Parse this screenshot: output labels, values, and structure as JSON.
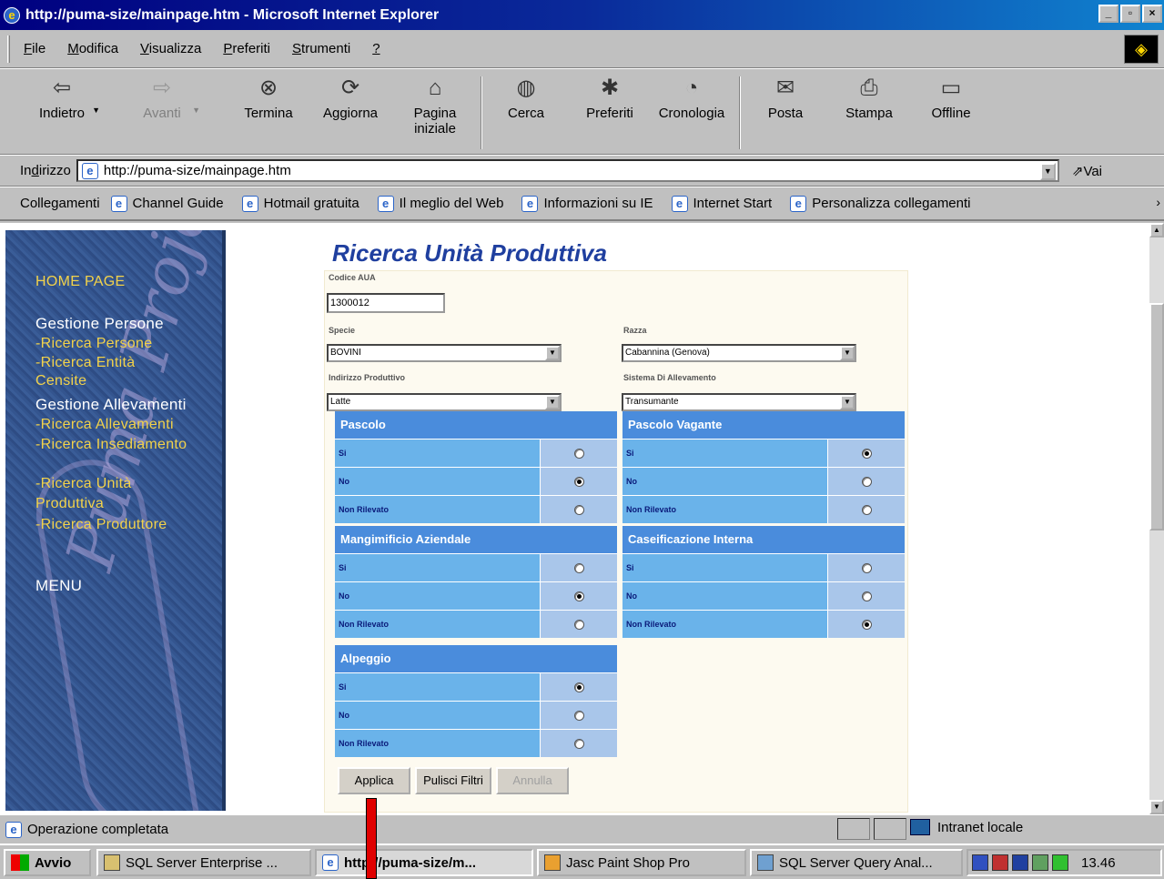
{
  "window": {
    "title": "http://puma-size/mainpage.htm - Microsoft Internet Explorer",
    "controls": [
      "_",
      "▫",
      "×"
    ]
  },
  "menubar": {
    "items": [
      {
        "label": "File",
        "u": "F",
        "rest": "ile"
      },
      {
        "label": "Modifica",
        "u": "M",
        "rest": "odifica"
      },
      {
        "label": "Visualizza",
        "u": "V",
        "rest": "isualizza"
      },
      {
        "label": "Preferiti",
        "u": "P",
        "rest": "referiti"
      },
      {
        "label": "Strumenti",
        "u": "S",
        "rest": "trumenti"
      },
      {
        "label": "?",
        "u": "?",
        "rest": ""
      }
    ]
  },
  "toolbar": {
    "back": "Indietro",
    "forward": "Avanti",
    "stop": "Termina",
    "refresh": "Aggiorna",
    "home_line1": "Pagina",
    "home_line2": "iniziale",
    "search": "Cerca",
    "favorites": "Preferiti",
    "history": "Cronologia",
    "mail": "Posta",
    "print": "Stampa",
    "offline": "Offline"
  },
  "address": {
    "label_u": "d",
    "label_pre": "In",
    "label_post": "irizzo",
    "url": "http://puma-size/mainpage.htm",
    "go": "Vai"
  },
  "links": {
    "label": "Collegamenti",
    "items": [
      "Channel Guide",
      "Hotmail gratuita",
      "Il meglio del Web",
      "Informazioni su IE",
      "Internet Start",
      "Personalizza collegamenti"
    ]
  },
  "nav": {
    "home": "HOME PAGE",
    "section_persons": "Gestione Persone",
    "link_persons": "-Ricerca Persone",
    "link_entities_1": "-Ricerca Entità",
    "link_entities_2": "Censite",
    "section_farms": "Gestione Allevamenti",
    "link_farms": "-Ricerca Allevamenti",
    "link_settlement": "-Ricerca Insediamento",
    "link_units_1": "-Ricerca Unità",
    "link_units_2": "Produttiva",
    "link_producer": "-Ricerca Produttore",
    "menu": "MENU",
    "watermark": "Puma Project"
  },
  "form": {
    "title": "Ricerca Unità Produttiva",
    "codice_label": "Codice AUA",
    "codice_value": "1300012",
    "specie_label": "Specie",
    "specie_value": "BOVINI",
    "razza_label": "Razza",
    "razza_value": "Cabannina (Genova)",
    "indirizzo_label": "Indirizzo Produttivo",
    "indirizzo_value": "Latte",
    "sistema_label": "Sistema Di Allevamento",
    "sistema_value": "Transumante",
    "groups": {
      "pascolo": {
        "title": "Pascolo",
        "options": [
          "Si",
          "No",
          "Non Rilevato"
        ],
        "selected": 1
      },
      "pascolo_vagante": {
        "title": "Pascolo Vagante",
        "options": [
          "Si",
          "No",
          "Non Rilevato"
        ],
        "selected": 0
      },
      "mangimificio": {
        "title": "Mangimificio Aziendale",
        "options": [
          "Si",
          "No",
          "Non Rilevato"
        ],
        "selected": 1
      },
      "caseificazione": {
        "title": "Caseificazione Interna",
        "options": [
          "Si",
          "No",
          "Non Rilevato"
        ],
        "selected": 2
      },
      "alpeggio": {
        "title": "Alpeggio",
        "options": [
          "Si",
          "No",
          "Non Rilevato"
        ],
        "selected": 0
      }
    },
    "btn_apply": "Applica",
    "btn_clear": "Pulisci Filtri",
    "btn_cancel": "Annulla"
  },
  "status": {
    "text": "Operazione completata",
    "zone": "Intranet locale"
  },
  "taskbar": {
    "start": "Avvio",
    "tasks": [
      "SQL Server Enterprise ...",
      "http://puma-size/m...",
      "Jasc Paint Shop Pro",
      "SQL Server Query Anal..."
    ],
    "clock": "13.46"
  }
}
